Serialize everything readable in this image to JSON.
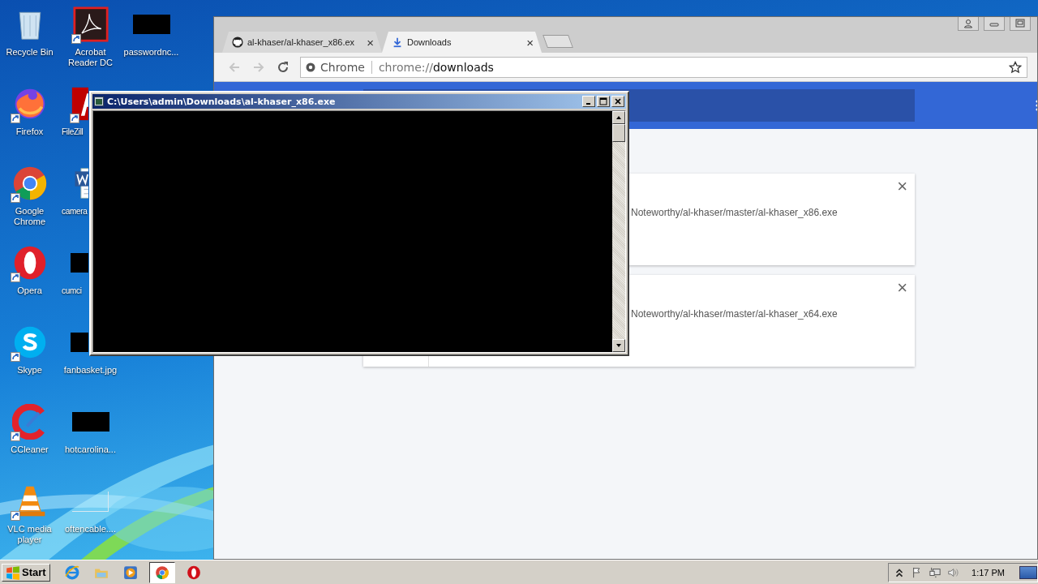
{
  "desktop": {
    "icons": [
      {
        "label": "Recycle Bin",
        "kind": "recycle-bin",
        "shortcut": false
      },
      {
        "label": "Firefox",
        "kind": "firefox",
        "shortcut": true
      },
      {
        "label": "Google Chrome",
        "kind": "chrome",
        "shortcut": true
      },
      {
        "label": "Opera",
        "kind": "opera",
        "shortcut": true
      },
      {
        "label": "Skype",
        "kind": "skype",
        "shortcut": true
      },
      {
        "label": "CCleaner",
        "kind": "ccleaner",
        "shortcut": true
      },
      {
        "label": "VLC media player",
        "kind": "vlc",
        "shortcut": true
      },
      {
        "label": "Acrobat Reader DC",
        "kind": "acrobat",
        "shortcut": true
      },
      {
        "label": "FileZill",
        "kind": "filezilla",
        "shortcut": true
      },
      {
        "label": "camera",
        "kind": "word-doc",
        "shortcut": false
      },
      {
        "label": "cumci",
        "kind": "redacted",
        "shortcut": false
      },
      {
        "label": "fanbasket.jpg",
        "kind": "redacted",
        "shortcut": false
      },
      {
        "label": "hotcarolina...",
        "kind": "redacted",
        "shortcut": false
      },
      {
        "label": "oftencable....",
        "kind": "blank-thumb",
        "shortcut": false
      },
      {
        "label": "passwordnc...",
        "kind": "redacted",
        "shortcut": false
      }
    ]
  },
  "browser": {
    "tabs": [
      {
        "title": "al-khaser/al-khaser_x86.ex",
        "kind": "github",
        "selected": false,
        "close": "×"
      },
      {
        "title": "Downloads",
        "kind": "download",
        "selected": true,
        "close": "×"
      }
    ],
    "nav_buttons": [
      {
        "kind": "back",
        "disabled": true
      },
      {
        "kind": "forward",
        "disabled": true
      },
      {
        "kind": "reload",
        "disabled": false
      }
    ],
    "omnibox": {
      "chip": "Chrome",
      "url_scheme": "chrome://",
      "url_path": "downloads"
    },
    "downloads": [
      {
        "url": "Noteworthy/al-khaser/master/al-khaser_x86.exe",
        "close": "×"
      },
      {
        "url": "Noteworthy/al-khaser/master/al-khaser_x64.exe",
        "close": "×"
      }
    ]
  },
  "console": {
    "title": "C:\\Users\\admin\\Downloads\\al-khaser_x86.exe"
  },
  "taskbar": {
    "start": "Start",
    "apps": [
      {
        "kind": "ie",
        "selected": false
      },
      {
        "kind": "explorer",
        "selected": false
      },
      {
        "kind": "media",
        "selected": false
      },
      {
        "kind": "chrome",
        "selected": true
      },
      {
        "kind": "opera",
        "selected": false
      }
    ],
    "tray": {
      "clock": "1:17 PM"
    }
  }
}
